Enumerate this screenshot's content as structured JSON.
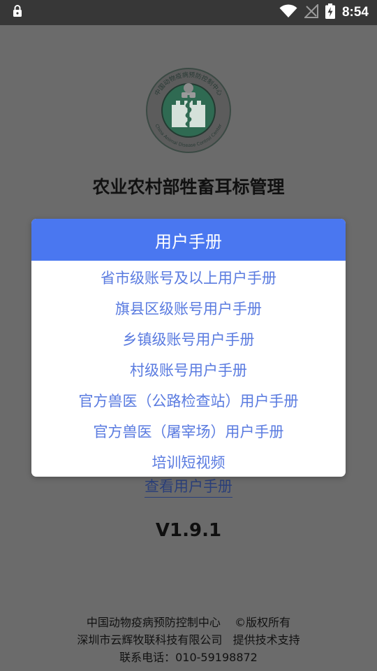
{
  "status_bar": {
    "time": "8:54"
  },
  "app": {
    "title": "农业农村部牲畜耳标管理",
    "logo_ring_text": "中国动物疫病预防控制中心",
    "logo_ring_text_en": "China Animal Disease Control Center",
    "view_manual_link": "查看用户手册",
    "version": "V1.9.1"
  },
  "footer": {
    "line1": "中国动物疫病预防控制中心    ©版权所有",
    "line2": "深圳市云辉牧联科技有限公司   提供技术支持",
    "line3": "联系电话：010-59198872"
  },
  "dialog": {
    "title": "用户手册",
    "items": [
      {
        "label": "省市级账号及以上用户手册"
      },
      {
        "label": "旗县区级账号用户手册"
      },
      {
        "label": "乡镇级账号用户手册"
      },
      {
        "label": "村级账号用户手册"
      },
      {
        "label": "官方兽医（公路检查站）用户手册"
      },
      {
        "label": "官方兽医（屠宰场）用户手册"
      },
      {
        "label": "培训短视频"
      }
    ]
  },
  "colors": {
    "dialog_header": "#4a77f0",
    "dialog_item_text": "#5a7be0",
    "overlay": "#6b6b6b",
    "status_bar": "#373737"
  },
  "icons": {
    "status_left": "lock-icon",
    "wifi": "wifi-icon",
    "no_signal": "no-signal-icon",
    "battery": "battery-charging-icon"
  }
}
